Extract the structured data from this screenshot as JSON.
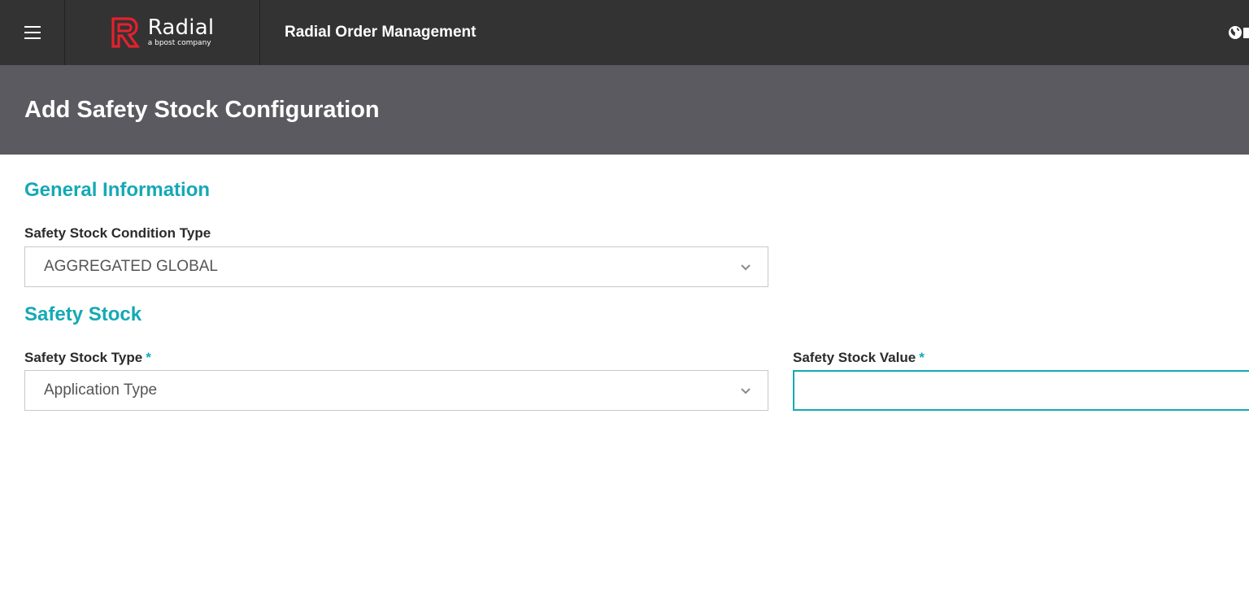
{
  "app": {
    "brand_name": "Radial",
    "brand_tagline": "a bpost company",
    "title": "Radial Order Management"
  },
  "page": {
    "title": "Add Safety Stock Configuration"
  },
  "sections": {
    "general": {
      "heading": "General Information",
      "condition_type_label": "Safety Stock Condition Type",
      "condition_type_value": "AGGREGATED GLOBAL"
    },
    "safety_stock": {
      "heading": "Safety Stock",
      "type_label": "Safety Stock Type",
      "type_required": "*",
      "type_value": "Application Type",
      "value_label": "Safety Stock Value",
      "value_required": "*",
      "value_input": ""
    }
  },
  "icons": {
    "menu": "hamburger-icon",
    "logo": "radial-logo-icon",
    "globe": "globe-icon",
    "dropdown": "chevron-down-icon"
  },
  "colors": {
    "topbar": "#333333",
    "page_header": "#5b5a60",
    "accent": "#15a9b5",
    "brand_red": "#e4212d"
  }
}
